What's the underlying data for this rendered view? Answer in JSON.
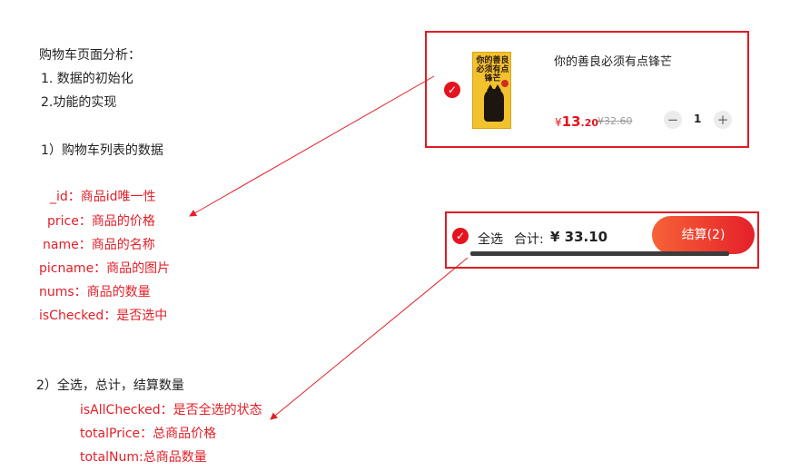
{
  "notes": {
    "heading": "购物车页面分析：",
    "step1": "1. 数据的初始化",
    "step2": "2.功能的实现",
    "section1": "1）购物车列表的数据",
    "fields1": [
      "_id：商品id唯一性",
      "price：商品的价格",
      "name：商品的名称",
      "picname：商品的图片",
      "nums：商品的数量",
      "isChecked：是否选中"
    ],
    "section2": "2）全选，总计，结算数量",
    "fields2": [
      "isAllChecked：是否全选的状态",
      "totalPrice：总商品价格",
      "totalNum:总商品数量"
    ]
  },
  "cart_item": {
    "book_cover_text": "你的善良必须有点锋芒",
    "name": "你的善良必须有点锋芒",
    "price_currency": "¥",
    "price_integer": "13",
    "price_decimal": ".20",
    "original_price": "¥32.60",
    "quantity": "1",
    "minus_symbol": "−",
    "plus_symbol": "+",
    "check_icon": "check-circle-icon"
  },
  "cart_footer": {
    "select_all_label": "全选",
    "total_label": "合计:",
    "total_value": "¥ 33.10",
    "checkout_label": "结算(2)"
  },
  "colors": {
    "annotation_red": "#e0202a",
    "frame_red": "#e01b24",
    "check_red": "#e4141e",
    "checkout_gradient_start": "#f76237",
    "checkout_gradient_end": "#e5202a"
  }
}
